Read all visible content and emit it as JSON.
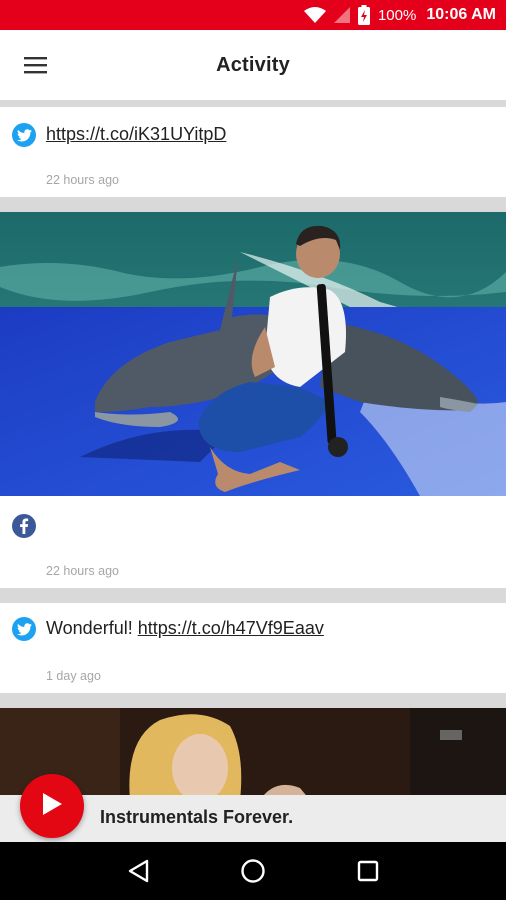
{
  "status_bar": {
    "battery_percent": "100%",
    "time": "10:06 AM",
    "icons": [
      "wifi-icon",
      "signal-icon",
      "battery-charging-icon"
    ]
  },
  "app_bar": {
    "title": "Activity",
    "menu_icon": "hamburger-menu-icon"
  },
  "feed": [
    {
      "source": "twitter",
      "icon": "twitter-icon",
      "text_prefix": "",
      "link": "https://t.co/iK31UYitpD",
      "time": "22 hours ago"
    },
    {
      "source": "facebook",
      "icon": "facebook-icon",
      "media": "photo of a man playing clarinet sitting between two dolphins",
      "text_prefix": "",
      "link": "",
      "time": "22 hours ago"
    },
    {
      "source": "twitter",
      "icon": "twitter-icon",
      "text_prefix": "Wonderful! ",
      "link": "https://t.co/h47Vf9Eaav",
      "time": "1 day ago"
    },
    {
      "source": "media",
      "media": "photo of a blonde woman playing violin, NRK logo"
    }
  ],
  "now_playing": {
    "label": "Instrumentals Forever.",
    "play_icon": "play-icon"
  },
  "nav_bar": {
    "buttons": [
      "back-icon",
      "home-icon",
      "recents-icon"
    ]
  },
  "colors": {
    "accent": "#e4001b",
    "twitter": "#1da1f2",
    "facebook": "#3b5998"
  }
}
